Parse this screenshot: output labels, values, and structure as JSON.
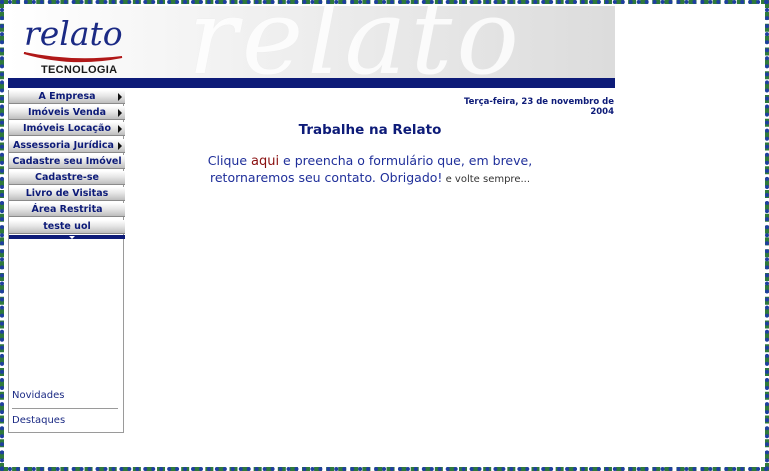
{
  "header": {
    "logo_text": "relato",
    "logo_sub": "TECNOLOGIA",
    "watermark": "relato"
  },
  "menu": {
    "items": [
      {
        "label": "A Empresa",
        "submenu": true
      },
      {
        "label": "Imóveis Venda",
        "submenu": true
      },
      {
        "label": "Imóveis Locação",
        "submenu": true
      },
      {
        "label": "Assessoria Jurídica",
        "submenu": true
      },
      {
        "label": "Cadastre seu Imóvel",
        "submenu": false
      },
      {
        "label": "Cadastre-se",
        "submenu": false
      },
      {
        "label": "Livro de Visitas",
        "submenu": false
      },
      {
        "label": "Área Restrita",
        "submenu": false
      },
      {
        "label": "teste uol",
        "submenu": false
      }
    ]
  },
  "sidebar": {
    "novidades": "Novidades",
    "destaques": "Destaques"
  },
  "main": {
    "date": "Terça-feira, 23 de novembro de 2004",
    "title": "Trabalhe na Relato",
    "text_before_link": "Clique ",
    "link_text": "aqui",
    "text_after_link": " e preencha o formulário que, em breve, retornaremos seu contato. Obrigado!",
    "text_small": " e volte sempre..."
  },
  "colors": {
    "navy": "#0d1b78",
    "link_red": "#8a1010",
    "frame_green": "#2f7a3a"
  }
}
